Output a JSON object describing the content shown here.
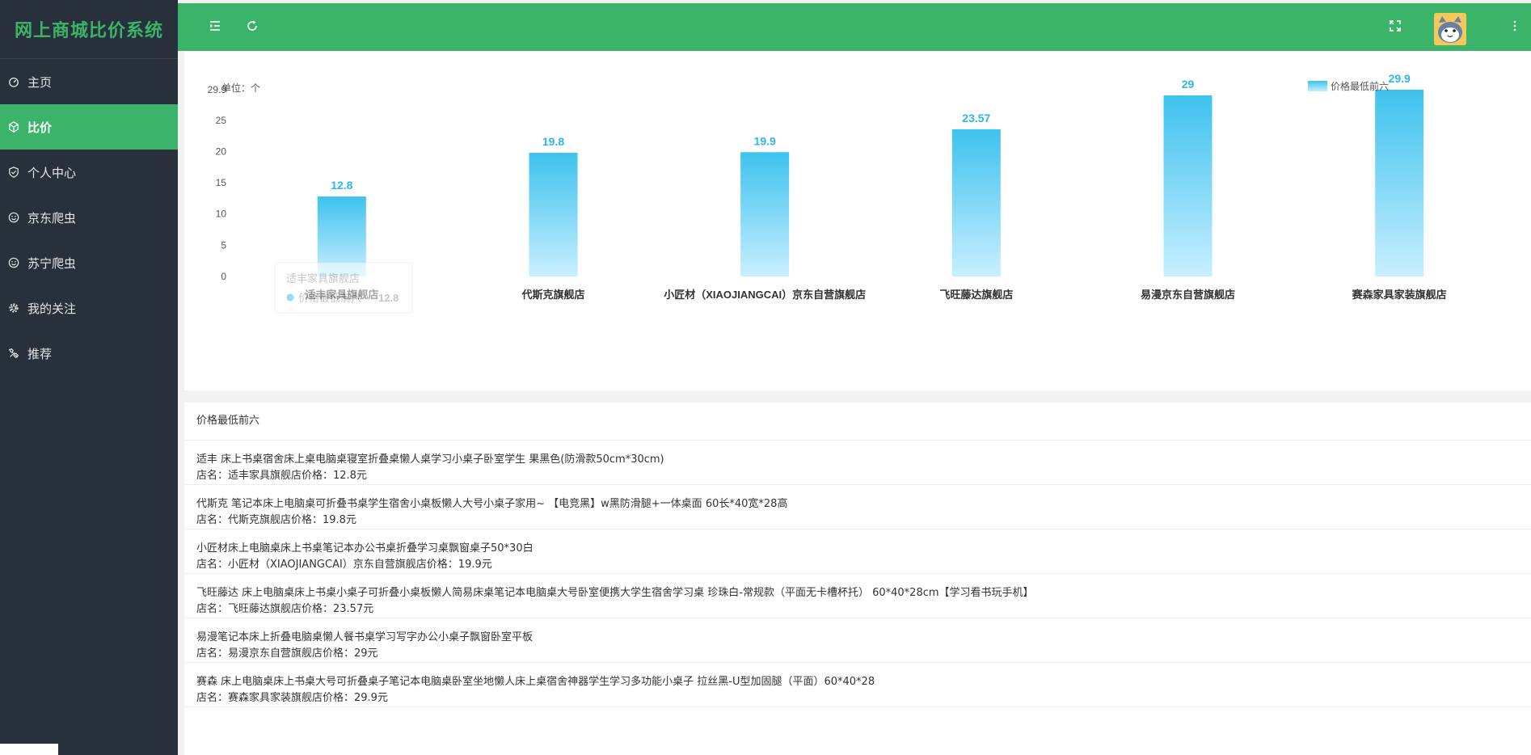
{
  "app": {
    "title": "网上商城比价系统"
  },
  "sidebar": {
    "items": [
      {
        "label": "主页",
        "icon": "dashboard-icon",
        "active": false
      },
      {
        "label": "比价",
        "icon": "cube-icon",
        "active": true
      },
      {
        "label": "个人中心",
        "icon": "shield-icon",
        "active": false
      },
      {
        "label": "京东爬虫",
        "icon": "smile-icon",
        "active": false
      },
      {
        "label": "苏宁爬虫",
        "icon": "smile-icon",
        "active": false
      },
      {
        "label": "我的关注",
        "icon": "gear-icon",
        "active": false
      },
      {
        "label": "推荐",
        "icon": "tools-icon",
        "active": false
      }
    ]
  },
  "header": {
    "menu_icon": "menu-indent-icon",
    "refresh_icon": "refresh-icon",
    "fullscreen_icon": "fullscreen-icon",
    "more_icon": "more-vertical-icon",
    "avatar_icon": "cat-avatar-icon"
  },
  "chart_data": {
    "type": "bar",
    "unit_label": "单位：个",
    "legend": {
      "label": "价格最低前六",
      "position": "top-right"
    },
    "categories": [
      "适丰家具旗舰店",
      "代斯克旗舰店",
      "小匠材（XIAOJIANGCAI）京东自营旗舰店",
      "飞旺藤达旗舰店",
      "易漫京东自营旗舰店",
      "赛森家具家装旗舰店"
    ],
    "series": [
      {
        "name": "价格最低前六",
        "values": [
          12.8,
          19.8,
          19.9,
          23.57,
          29,
          29.9
        ]
      }
    ],
    "y_ticks": [
      "0",
      "5",
      "10",
      "15",
      "20",
      "25",
      "29.9"
    ],
    "ylim": [
      0,
      29.9
    ],
    "colors": {
      "bar_top": "#3ec2ee",
      "bar_bottom": "#c8efff",
      "label": "#2eb6e8"
    },
    "tooltip": {
      "title": "适丰家具旗舰店",
      "series": "价格最低前六",
      "value": "12.8"
    }
  },
  "list": {
    "title": "价格最低前六",
    "items": [
      {
        "name": "适丰 床上书桌宿舍床上桌电脑桌寝室折叠桌懒人桌学习小桌子卧室学生 果黑色(防滑款50cm*30cm)",
        "detail": "店名：适丰家具旗舰店价格：12.8元"
      },
      {
        "name": "代斯克 笔记本床上电脑桌可折叠书桌学生宿舍小桌板懒人大号小桌子家用~ 【电竞黑】w黑防滑腿+一体桌面 60长*40宽*28高",
        "detail": "店名：代斯克旗舰店价格：19.8元"
      },
      {
        "name": "小匠材床上电脑桌床上书桌笔记本办公书桌折叠学习桌飘窗桌子50*30白",
        "detail": "店名：小匠材（XIAOJIANGCAI）京东自营旗舰店价格：19.9元"
      },
      {
        "name": "飞旺藤达 床上电脑桌床上书桌小桌子可折叠小桌板懒人简易床桌笔记本电脑桌大号卧室便携大学生宿舍学习桌 珍珠白-常规款（平面无卡槽杯托） 60*40*28cm【学习看书玩手机】",
        "detail": "店名：飞旺藤达旗舰店价格：23.57元"
      },
      {
        "name": "易漫笔记本床上折叠电脑桌懒人餐书桌学习写字办公小桌子飘窗卧室平板",
        "detail": "店名：易漫京东自营旗舰店价格：29元"
      },
      {
        "name": "赛森 床上电脑桌床上书桌大号可折叠桌子笔记本电脑桌卧室坐地懒人床上桌宿舍神器学生学习多功能小桌子 拉丝黑-U型加固腿（平面）60*40*28",
        "detail": "店名：赛森家具家装旗舰店价格：29.9元"
      }
    ]
  }
}
